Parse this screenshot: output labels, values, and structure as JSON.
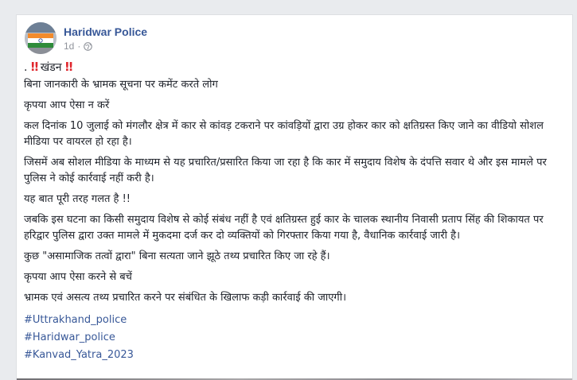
{
  "post": {
    "author": "Haridwar Police",
    "timestamp": "1d",
    "separator": "·",
    "privacy_icon": "globe-icon",
    "title_prefix": ".",
    "title_mark": "‼",
    "title_text": "खंडन",
    "paragraphs": [
      "बिना जानकारी के भ्रामक सूचना पर कमेंट करते लोग",
      "कृपया आप ऐसा न करें",
      "कल दिनांक 10 जुलाई को मंगलौर क्षेत्र में कार से कांवड़ टकराने पर कांवड़ियों द्वारा उग्र होकर कार को क्षतिग्रस्त किए जाने का वीडियो सोशल मीडिया पर वायरल हो रहा है।",
      "जिसमें अब सोशल मीडिया के माध्यम से यह प्रचारित/प्रसारित किया जा रहा है कि कार में समुदाय विशेष के दंपत्ति सवार थे और इस मामले पर पुलिस ने कोई कार्रवाई नहीं करी है।",
      "यह बात पूरी तरह गलत है !!",
      "जबकि इस घटना का किसी समुदाय विशेष से कोई संबंध नहीं है एवं क्षतिग्रस्त हुई कार के चालक स्थानीय निवासी प्रताप सिंह की शिकायत पर हरिद्वार पुलिस द्वारा उक्त मामले में मुकदमा दर्ज कर दो व्यक्तियों को गिरफ्तार किया गया है, वैधानिक कार्रवाई जारी है।",
      "कुछ \"असामाजिक तत्वों द्वारा\" बिना सत्यता जाने झूठे तथ्य प्रचारित किए जा रहे हैं।",
      "कृपया आप ऐसा करने से बचें",
      "भ्रामक एवं असत्य तथ्य प्रचारित करने पर संबंधित के खिलाफ कड़ी कार्रवाई की जाएगी।"
    ],
    "hashtags": [
      "#Uttrakhand_police",
      "#Haridwar_police",
      "#Kanvad_Yatra_2023"
    ]
  },
  "colors": {
    "link": "#385898",
    "text": "#1d2129",
    "meta": "#90949c",
    "alert": "#e0262d",
    "background": "#e9ebee"
  }
}
